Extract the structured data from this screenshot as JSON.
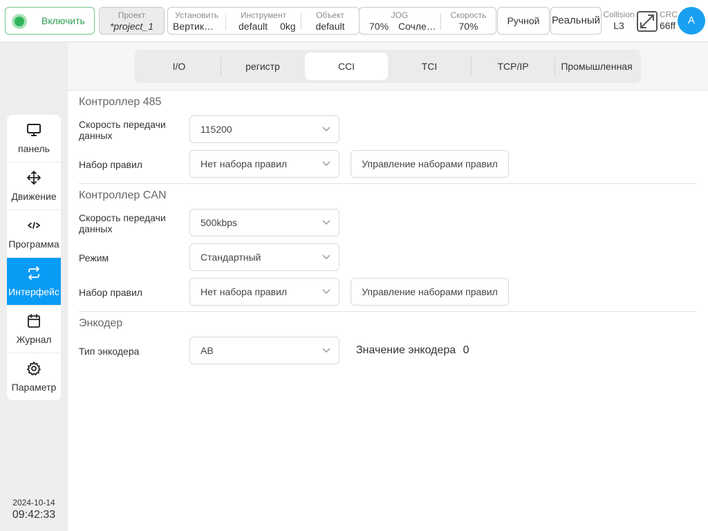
{
  "topbar": {
    "power_label": "Включить",
    "project": {
      "caption": "Проект",
      "value": "*project_1"
    },
    "install": {
      "caption": "Установить",
      "value": "Вертик…"
    },
    "tool": {
      "caption": "Инструмент",
      "value": "default",
      "weight": "0kg"
    },
    "object": {
      "caption": "Объект",
      "value": "default"
    },
    "jog": {
      "caption": "JOG",
      "value": "70%",
      "mode": "Сочле…"
    },
    "speed": {
      "caption": "Скорость",
      "value": "70%"
    },
    "manual_label": "Ручной",
    "real_label": "Реальный",
    "collision": {
      "caption": "Collision",
      "value": "L3"
    },
    "crc": {
      "caption": "CRC",
      "value": "66ff"
    },
    "avatar": "A"
  },
  "sidebar": {
    "items": [
      {
        "label": "панель",
        "icon": "monitor-icon"
      },
      {
        "label": "Движение",
        "icon": "move-icon"
      },
      {
        "label": "Программа",
        "icon": "code-icon"
      },
      {
        "label": "Интерфейс",
        "icon": "swap-icon",
        "active": true
      },
      {
        "label": "Журнал",
        "icon": "calendar-icon"
      },
      {
        "label": "Параметр",
        "icon": "gear-icon"
      }
    ],
    "date": "2024-10-14",
    "time": "09:42:33"
  },
  "tabs": [
    {
      "label": "I/O"
    },
    {
      "label": "регистр"
    },
    {
      "label": "CCI",
      "active": true
    },
    {
      "label": "TCI"
    },
    {
      "label": "TCP/IP"
    },
    {
      "label": "Промышленная"
    }
  ],
  "rs485": {
    "title": "Контроллер 485",
    "baud_label": "Скорость передачи данных",
    "baud_value": "115200",
    "ruleset_label": "Набор правил",
    "ruleset_value": "Нет набора правил",
    "manage_label": "Управление наборами правил"
  },
  "can": {
    "title": "Контроллер CAN",
    "baud_label": "Скорость передачи данных",
    "baud_value": "500kbps",
    "mode_label": "Режим",
    "mode_value": "Стандартный",
    "ruleset_label": "Набор правил",
    "ruleset_value": "Нет набора правил",
    "manage_label": "Управление наборами правил"
  },
  "encoder": {
    "title": "Энкодер",
    "type_label": "Тип энкодера",
    "type_value": "AB",
    "value_label": "Значение энкодера",
    "value": "0"
  },
  "colors": {
    "accent": "#0a9bf5",
    "power_green": "#2fb35a",
    "avatar": "#1aa0f0"
  }
}
